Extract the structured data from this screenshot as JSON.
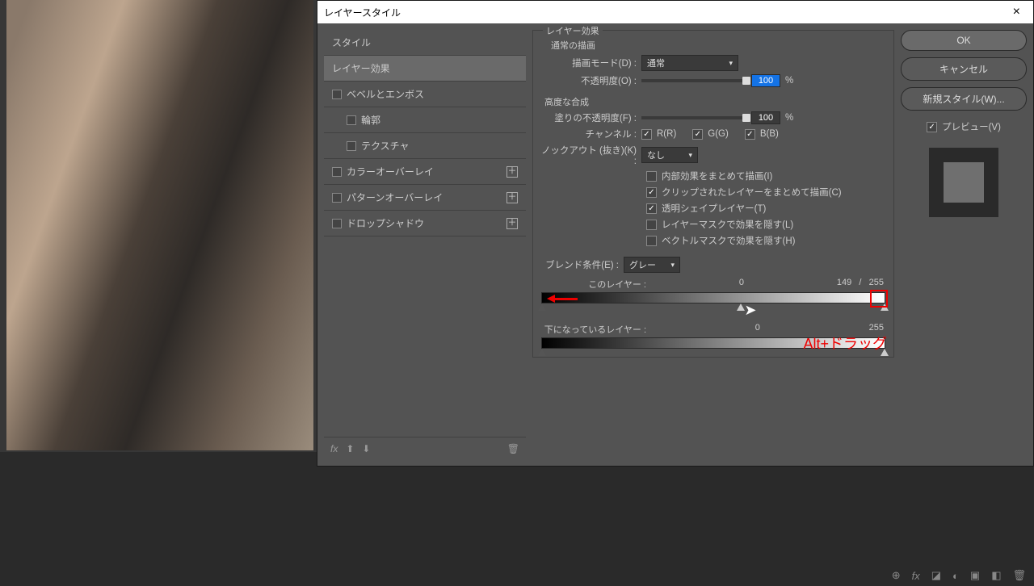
{
  "dialog": {
    "title": "レイヤースタイル",
    "close": "×"
  },
  "styles": {
    "header": "スタイル",
    "blending": "レイヤー効果",
    "bevel": "ベベルとエンボス",
    "contour": "輪郭",
    "texture": "テクスチャ",
    "colorOverlay": "カラーオーバーレイ",
    "patternOverlay": "パターンオーバーレイ",
    "dropShadow": "ドロップシャドウ",
    "fx": "fx",
    "plus": "＋"
  },
  "effects": {
    "groupTitle": "レイヤー効果",
    "normalBlending": "通常の描画",
    "blendModeLabel": "描画モード(D) :",
    "blendModeValue": "通常",
    "opacityLabel": "不透明度(O) :",
    "opacityValue": "100",
    "percent": "%"
  },
  "advanced": {
    "title": "高度な合成",
    "fillOpacityLabel": "塗りの不透明度(F) :",
    "fillOpacityValue": "100",
    "channelsLabel": "チャンネル :",
    "chR": "R(R)",
    "chG": "G(G)",
    "chB": "B(B)",
    "knockoutLabel": "ノックアウト (抜き)(K) :",
    "knockoutValue": "なし",
    "blendInterior": "内部効果をまとめて描画(I)",
    "blendClipped": "クリップされたレイヤーをまとめて描画(C)",
    "transparencyShapes": "透明シェイプレイヤー(T)",
    "layerMaskHides": "レイヤーマスクで効果を隠す(L)",
    "vectorMaskHides": "ベクトルマスクで効果を隠す(H)"
  },
  "blendIf": {
    "label": "ブレンド条件(E) :",
    "value": "グレー",
    "thisLayer": "このレイヤー :",
    "thisMin": "0",
    "thisSplit": "149",
    "slash": "/",
    "thisMax": "255",
    "underlying": "下になっているレイヤー :",
    "underMin": "0",
    "underMax": "255"
  },
  "annotation": "Alt+ドラッグ",
  "buttons": {
    "ok": "OK",
    "cancel": "キャンセル",
    "newStyle": "新規スタイル(W)...",
    "preview": "プレビュー(V)"
  },
  "statusIcons": [
    "⊕",
    "fx",
    "◪",
    "◐",
    "▣",
    "◧",
    "⊞",
    "🗑"
  ]
}
